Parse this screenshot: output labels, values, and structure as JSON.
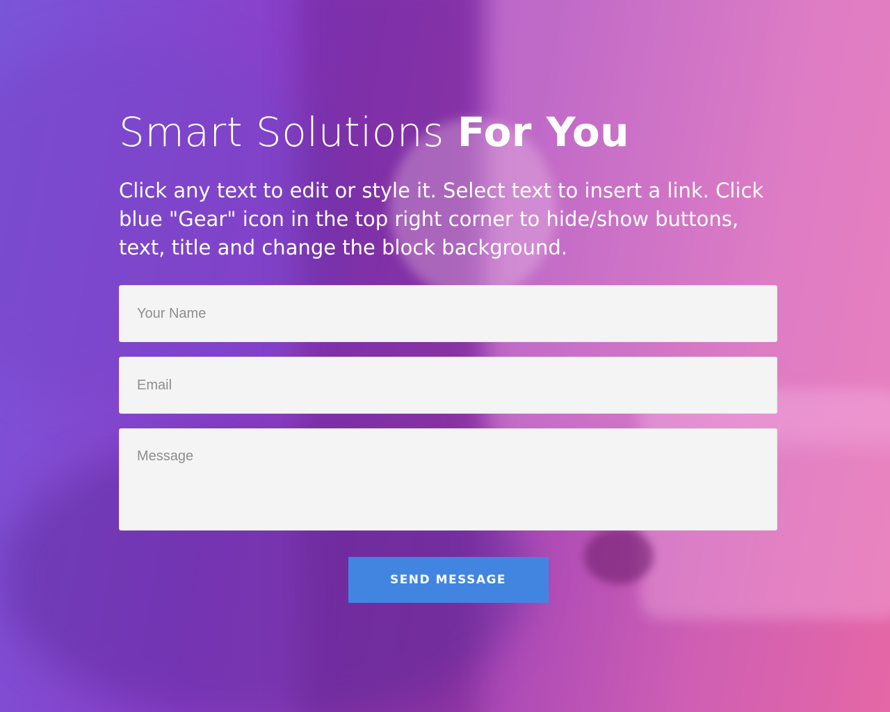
{
  "hero": {
    "title_light": "Smart Solutions",
    "title_bold": "For You",
    "description": "Click any text to edit or style it. Select text to insert a link. Click blue \"Gear\" icon in the top right corner to hide/show buttons, text, title and change the block background."
  },
  "form": {
    "name_placeholder": "Your Name",
    "email_placeholder": "Email",
    "message_placeholder": "Message",
    "submit_label": "SEND MESSAGE"
  },
  "colors": {
    "button": "#4285e0",
    "field_background": "#f4f4f4",
    "text": "#ffffff"
  }
}
